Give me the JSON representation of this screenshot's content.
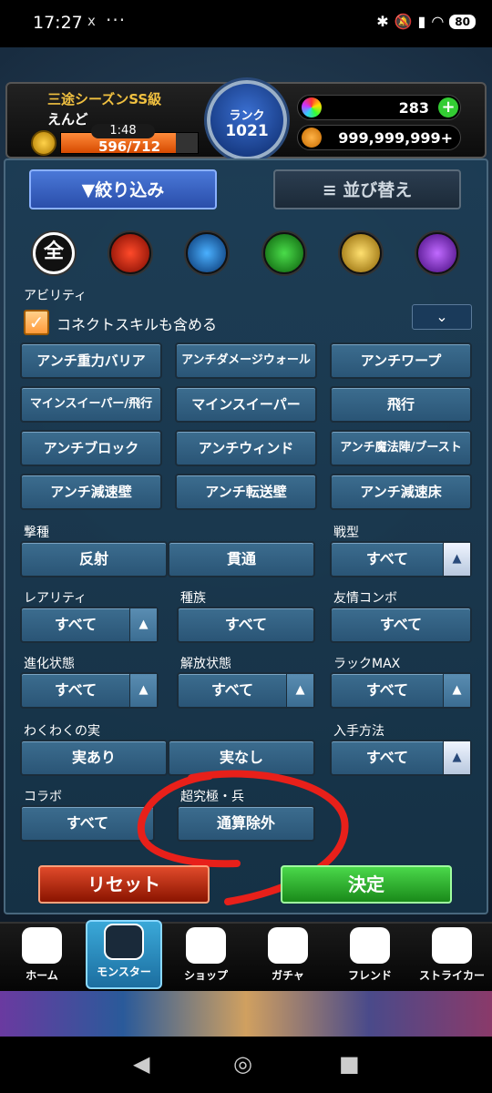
{
  "status": {
    "time": "17:27",
    "x": "x",
    "dots": "···",
    "battery": "80"
  },
  "header": {
    "season": "三途シーズンSS級",
    "name": "えんど",
    "timer": "1:48",
    "xp": "596/712",
    "xp_fraction": 0.84,
    "rank_label": "ランク",
    "rank": "1021",
    "orbs": "283",
    "gold": "999,999,999+"
  },
  "filter": {
    "filter_label": "絞り込み",
    "sort_label": "並び替え",
    "all_label": "全",
    "ability_label": "アビリティ",
    "connect_label": "コネクトスキルも含める",
    "abilities": [
      "アンチ重力バリア",
      "アンチダメージウォール",
      "アンチワープ",
      "マインスイーパー/飛行",
      "マインスイーパー",
      "飛行",
      "アンチブロック",
      "アンチウィンド",
      "アンチ魔法陣/ブースト",
      "アンチ減速壁",
      "アンチ転送壁",
      "アンチ減速床"
    ],
    "geki_label": "撃種",
    "geki": [
      "反射",
      "貫通"
    ],
    "sengata_label": "戦型",
    "sengata": "すべて",
    "rarity_label": "レアリティ",
    "rarity": "すべて",
    "shuzoku_label": "種族",
    "shuzoku": "すべて",
    "yujo_label": "友情コンボ",
    "yujo": "すべて",
    "shinka_label": "進化状態",
    "shinka": "すべて",
    "kaiho_label": "解放状態",
    "kaiho": "すべて",
    "luck_label": "ラックMAX",
    "luck": "すべて",
    "waku_label": "わくわくの実",
    "waku": [
      "実あり",
      "実なし"
    ],
    "nyushu_label": "入手方法",
    "nyushu": "すべて",
    "collab_label": "コラボ",
    "collab": "すべて",
    "choukyu_label": "超究極・兵",
    "choukyu": "通算除外",
    "reset": "リセット",
    "ok": "決定"
  },
  "nav": [
    "ホーム",
    "モンスター",
    "ショップ",
    "ガチャ",
    "フレンド",
    "ストライカー"
  ],
  "sys": [
    "◀",
    "◎",
    "■"
  ]
}
